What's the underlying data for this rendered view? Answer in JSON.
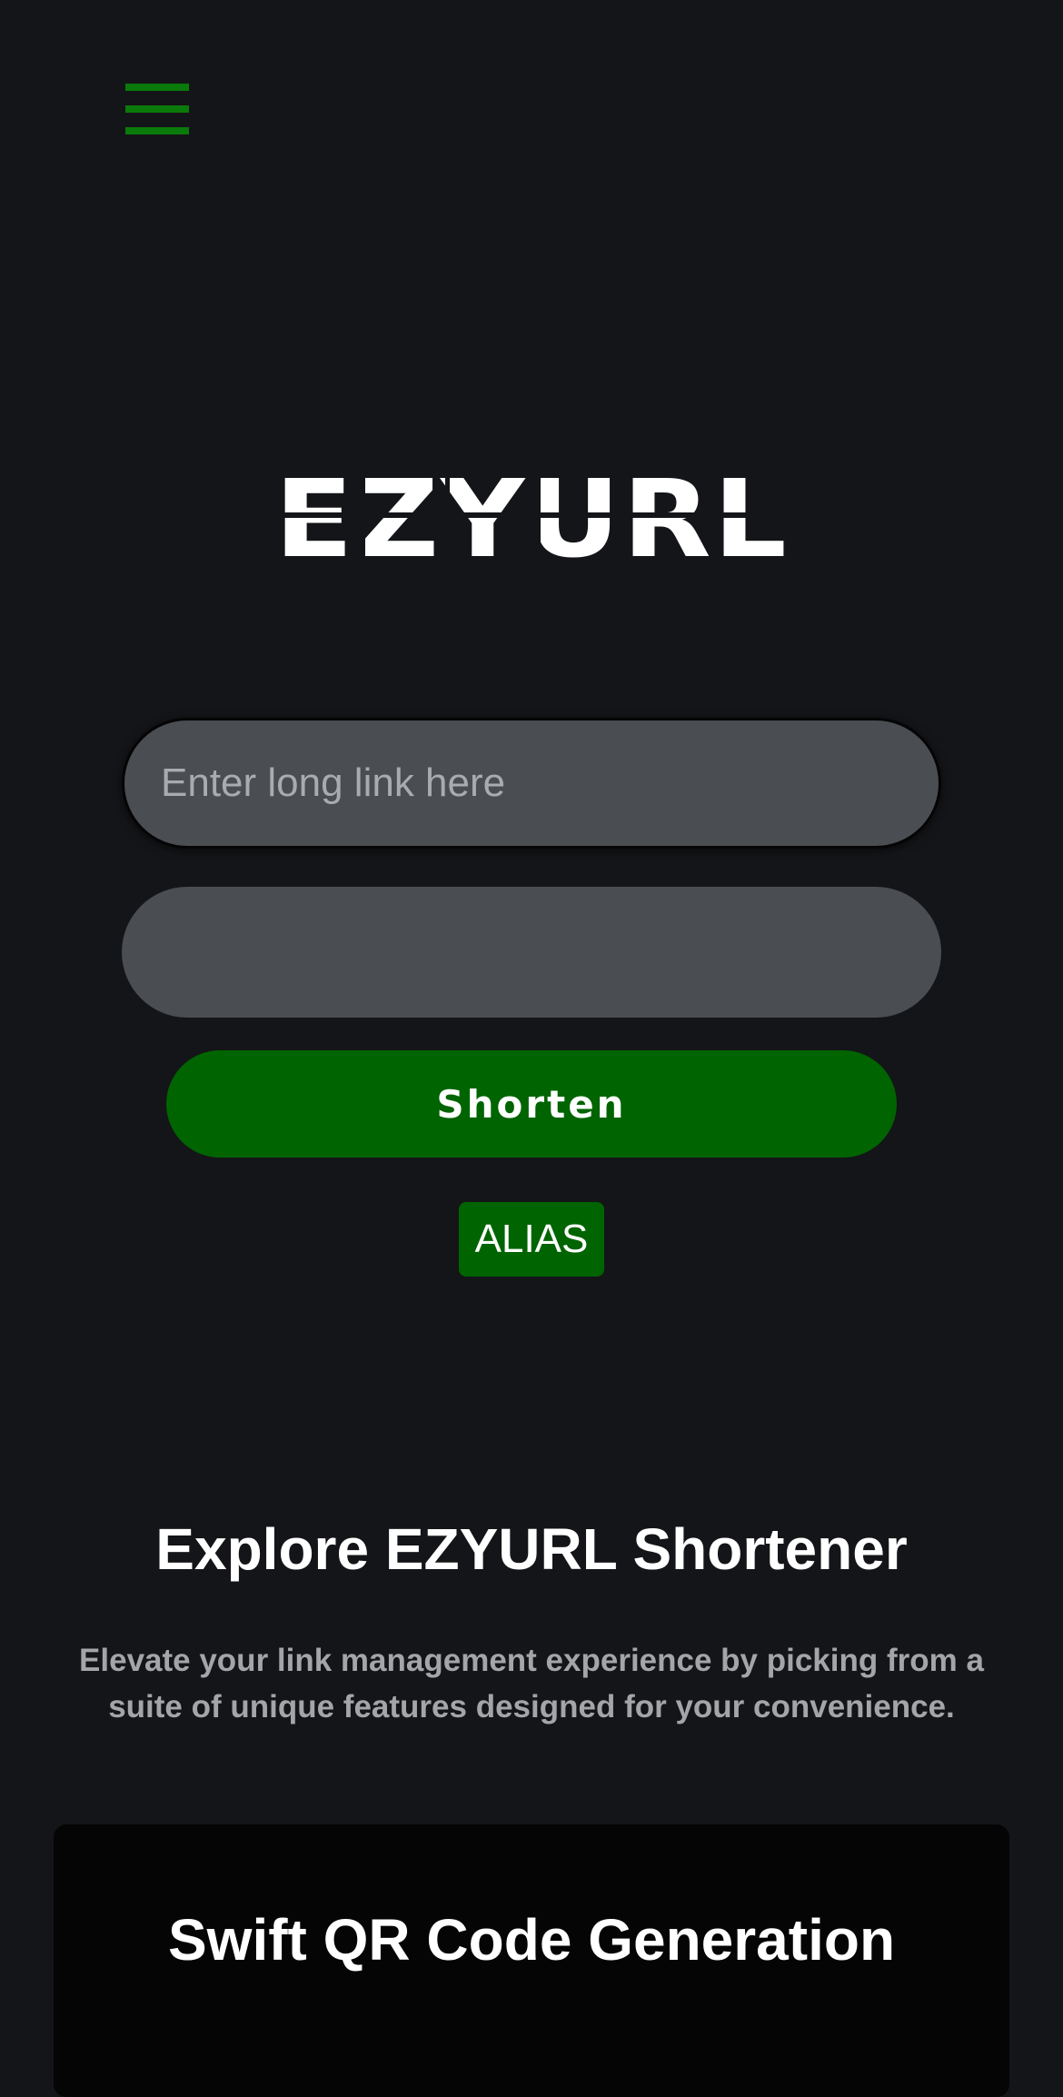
{
  "header": {
    "menu_icon": "hamburger-menu-icon"
  },
  "logo": {
    "text": "EZYURL"
  },
  "form": {
    "url_placeholder": "Enter long link here",
    "url_value": "",
    "alias_placeholder": "",
    "alias_value": "",
    "shorten_label": "Shorten",
    "alias_label": "ALIAS"
  },
  "features": {
    "title": "Explore EZYURL Shortener",
    "description": "Elevate your link management experience by picking from a suite of unique features designed for your convenience.",
    "cards": [
      {
        "title": "Swift QR Code Generation"
      }
    ]
  },
  "colors": {
    "background": "#141518",
    "accent": "#006400",
    "input_bg": "#4a4d51",
    "card_bg": "#050505"
  }
}
